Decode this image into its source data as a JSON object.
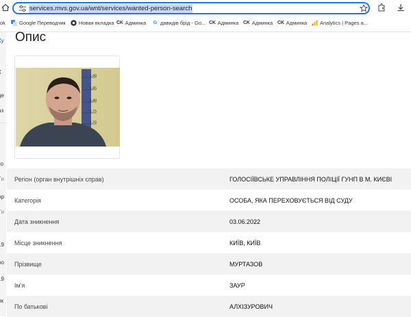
{
  "browser": {
    "url": "services.mvs.gov.ua/wnt/services/wanted-person-search",
    "bookmarks": [
      {
        "icon": "google-translate-icon",
        "label": "Google Переводчик"
      },
      {
        "icon": "chrome-icon",
        "label": "Новая вкладка"
      },
      {
        "icon": "ck-icon",
        "icon_text": "CK",
        "label": "Админка"
      },
      {
        "icon": "google-icon",
        "icon_text": "G",
        "label": "давидів брід - Go..."
      },
      {
        "icon": "ck-icon",
        "icon_text": "CK",
        "label": "Админка"
      },
      {
        "icon": "ck-icon",
        "icon_text": "CK",
        "label": "Админка"
      },
      {
        "icon": "ck-icon",
        "icon_text": "CK",
        "label": "Админка"
      },
      {
        "icon": "analytics-icon",
        "label": "Analytics | Pages a..."
      }
    ],
    "bookmark_fragment": "ok"
  },
  "sidebar_fragments": [
    "Ку",
    "К",
    "це",
    "аз",
    "ко",
    "Ти",
    "ор",
    "Ти",
    "19",
    "ро",
    "19",
    "ик"
  ],
  "page": {
    "title": "Опис"
  },
  "details": [
    {
      "label": "Регіон (орган внутрішніх справ)",
      "value": "ГОЛОСІЇВСЬКЕ УПРАВЛІННЯ ПОЛІЦІЇ ГУНП В М. КИЄВІ"
    },
    {
      "label": "Категорія",
      "value": "ОСОБА, ЯКА ПЕРЕХОВУЄТЬСЯ ВІД СУДУ"
    },
    {
      "label": "Дата зникнення",
      "value": "03.06.2022"
    },
    {
      "label": "Місце зникнення",
      "value": "КИЇВ, КИЇВ"
    },
    {
      "label": "Прізвище",
      "value": "МУРТАЗОВ"
    },
    {
      "label": "Ім'я",
      "value": "ЗАУР"
    },
    {
      "label": "По батькові",
      "value": "АЛХІЗУРОВИЧ"
    }
  ],
  "photo_ruler_marks": [
    "1,90",
    "1,85",
    "1,80",
    "1,75",
    "1,70",
    "1,65"
  ],
  "colors": {
    "accent": "#1a73e8",
    "row_alt": "#f2f2f2"
  }
}
